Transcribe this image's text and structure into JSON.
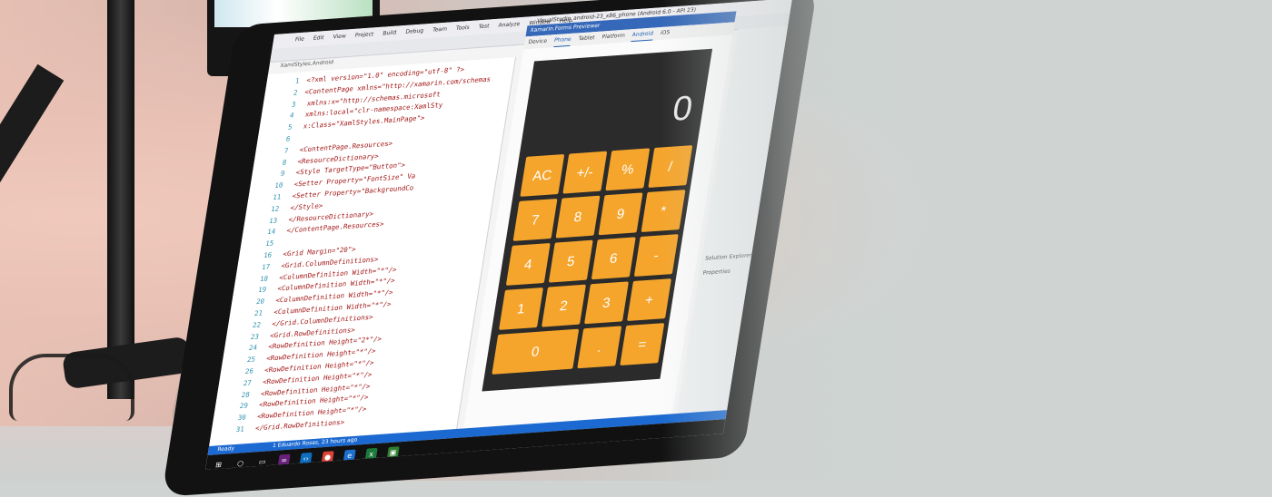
{
  "ide": {
    "menus": [
      "File",
      "Edit",
      "View",
      "Project",
      "Build",
      "Debug",
      "Team",
      "Tools",
      "Test",
      "Analyze",
      "Window",
      "Help"
    ],
    "doc_title": "VisualStudio_android-23_x86_phone (Android 6.0 - API 23)",
    "editor_tab": "XamlStyles.Android",
    "status": "Ready",
    "status_author": "1 Eduardo Rosas, 23 hours ago"
  },
  "code_lines": [
    {
      "n": "1",
      "t": "<?xml version=\"1.0\" encoding=\"utf-8\" ?>"
    },
    {
      "n": "2",
      "t": "<ContentPage xmlns=\"http://xamarin.com/schemas"
    },
    {
      "n": "3",
      "t": "             xmlns:x=\"http://schemas.microsoft"
    },
    {
      "n": "4",
      "t": "             xmlns:local=\"clr-namespace:XamlSty"
    },
    {
      "n": "5",
      "t": "             x:Class=\"XamlStyles.MainPage\">"
    },
    {
      "n": "6",
      "t": ""
    },
    {
      "n": "7",
      "t": "    <ContentPage.Resources>"
    },
    {
      "n": "8",
      "t": "        <ResourceDictionary>"
    },
    {
      "n": "9",
      "t": "            <Style TargetType=\"Button\">"
    },
    {
      "n": "10",
      "t": "                <Setter Property=\"FontSize\" Va"
    },
    {
      "n": "11",
      "t": "                <Setter Property=\"BackgroundCo"
    },
    {
      "n": "12",
      "t": "            </Style>"
    },
    {
      "n": "13",
      "t": "        </ResourceDictionary>"
    },
    {
      "n": "14",
      "t": "    </ContentPage.Resources>"
    },
    {
      "n": "15",
      "t": ""
    },
    {
      "n": "16",
      "t": "    <Grid Margin=\"20\">"
    },
    {
      "n": "17",
      "t": "        <Grid.ColumnDefinitions>"
    },
    {
      "n": "18",
      "t": "            <ColumnDefinition Width=\"*\"/>"
    },
    {
      "n": "19",
      "t": "            <ColumnDefinition Width=\"*\"/>"
    },
    {
      "n": "20",
      "t": "            <ColumnDefinition Width=\"*\"/>"
    },
    {
      "n": "21",
      "t": "            <ColumnDefinition Width=\"*\"/>"
    },
    {
      "n": "22",
      "t": "        </Grid.ColumnDefinitions>"
    },
    {
      "n": "23",
      "t": "        <Grid.RowDefinitions>"
    },
    {
      "n": "24",
      "t": "            <RowDefinition Height=\"2*\"/>"
    },
    {
      "n": "25",
      "t": "            <RowDefinition Height=\"*\"/>"
    },
    {
      "n": "26",
      "t": "            <RowDefinition Height=\"*\"/>"
    },
    {
      "n": "27",
      "t": "            <RowDefinition Height=\"*\"/>"
    },
    {
      "n": "28",
      "t": "            <RowDefinition Height=\"*\"/>"
    },
    {
      "n": "29",
      "t": "            <RowDefinition Height=\"*\"/>"
    },
    {
      "n": "30",
      "t": "            <RowDefinition Height=\"*\"/>"
    },
    {
      "n": "31",
      "t": "        </Grid.RowDefinitions>"
    }
  ],
  "previewer": {
    "title": "Xamarin.Forms Previewer",
    "device_label": "Device",
    "phone_label": "Phone",
    "tablet_label": "Tablet",
    "platform_label": "Platform",
    "android_label": "Android",
    "ios_label": "iOS"
  },
  "calculator": {
    "display": "0",
    "keys": [
      {
        "label": "AC",
        "name": "key-ac"
      },
      {
        "label": "+/-",
        "name": "key-plus-minus"
      },
      {
        "label": "%",
        "name": "key-percent"
      },
      {
        "label": "/",
        "name": "key-divide"
      },
      {
        "label": "7",
        "name": "key-7"
      },
      {
        "label": "8",
        "name": "key-8"
      },
      {
        "label": "9",
        "name": "key-9"
      },
      {
        "label": "*",
        "name": "key-multiply"
      },
      {
        "label": "4",
        "name": "key-4"
      },
      {
        "label": "5",
        "name": "key-5"
      },
      {
        "label": "6",
        "name": "key-6"
      },
      {
        "label": "-",
        "name": "key-minus"
      },
      {
        "label": "1",
        "name": "key-1"
      },
      {
        "label": "2",
        "name": "key-2"
      },
      {
        "label": "3",
        "name": "key-3"
      },
      {
        "label": "+",
        "name": "key-plus"
      },
      {
        "label": "0",
        "name": "key-0"
      },
      {
        "label": ".",
        "name": "key-decimal"
      },
      {
        "label": "=",
        "name": "key-equals"
      }
    ],
    "key_color": "#f5a52c",
    "body_color": "#2b2b2b"
  },
  "right_pane": {
    "solution_explorer": "Solution Explorer",
    "properties": "Properties"
  },
  "taskbar_icons": [
    "windows-start-icon",
    "search-icon",
    "task-view-icon",
    "visual-studio-icon",
    "vs-code-icon",
    "chrome-icon",
    "edge-icon",
    "excel-icon",
    "terminal-icon"
  ],
  "accent": "#1c6ad1"
}
